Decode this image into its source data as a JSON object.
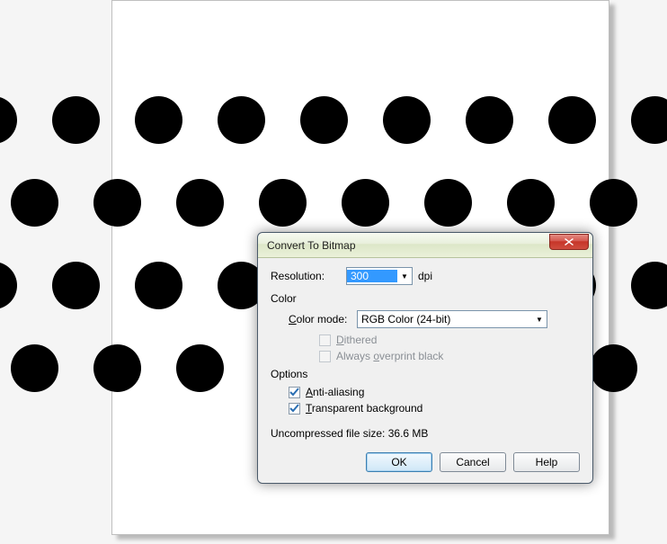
{
  "dialog": {
    "title": "Convert To Bitmap",
    "resolution_label": "Resolution:",
    "resolution_value": "300",
    "resolution_unit": "dpi",
    "color_section": "Color",
    "color_mode_label": "Color mode:",
    "color_mode_value": "RGB Color (24-bit)",
    "dithered_label_pre": "",
    "dithered_ul": "D",
    "dithered_label_post": "ithered",
    "always_overprint_pre": "Always ",
    "always_overprint_ul": "o",
    "always_overprint_post": "verprint black",
    "options_section": "Options",
    "aa_pre": "",
    "aa_ul": "A",
    "aa_post": "nti-aliasing",
    "tbg_pre": "",
    "tbg_ul": "T",
    "tbg_post": "ransparent background",
    "filesize_label": "Uncompressed file size:",
    "filesize_value": "36.6 MB",
    "ok": "OK",
    "cancel": "Cancel",
    "help": "Help"
  },
  "checkboxes": {
    "dithered": false,
    "always_overprint": false,
    "anti_aliasing": true,
    "transparent_bg": true
  }
}
